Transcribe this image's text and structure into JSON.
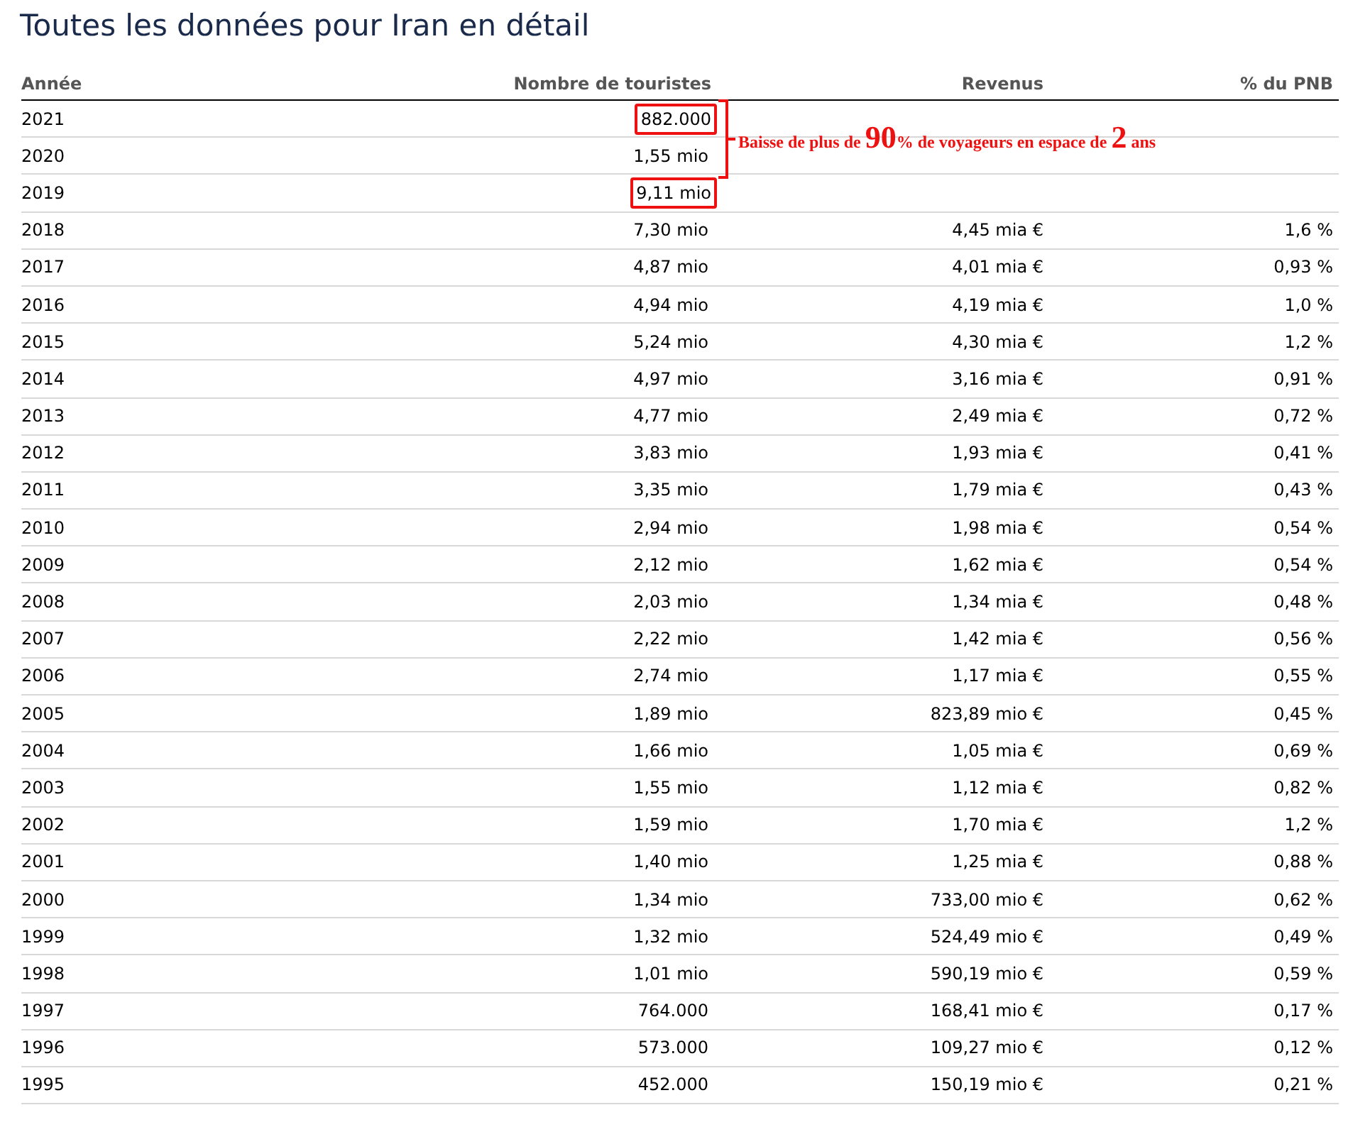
{
  "title": "Toutes les données pour Iran en détail",
  "columns": [
    "Année",
    "Nombre de touristes",
    "Revenus",
    "% du PNB"
  ],
  "rows": [
    {
      "year": "2021",
      "tourists": "882.000",
      "highlighted": true
    },
    {
      "year": "2020",
      "tourists": "1,55 mio",
      "highlighted": false
    },
    {
      "year": "2019",
      "tourists": "9,11 mio",
      "highlighted": true
    },
    {
      "year": "2018",
      "tourists": "7,30 mio",
      "revenue": "4,45 mia €",
      "gnp": "1,6 %",
      "highlighted": false
    },
    {
      "year": "2017",
      "tourists": "4,87 mio",
      "revenue": "4,01 mia €",
      "gnp": "0,93 %",
      "highlighted": false
    },
    {
      "year": "2016",
      "tourists": "4,94 mio",
      "revenue": "4,19 mia €",
      "gnp": "1,0 %",
      "highlighted": false
    },
    {
      "year": "2015",
      "tourists": "5,24 mio",
      "revenue": "4,30 mia €",
      "gnp": "1,2 %",
      "highlighted": false
    },
    {
      "year": "2014",
      "tourists": "4,97 mio",
      "revenue": "3,16 mia €",
      "gnp": "0,91 %",
      "highlighted": false
    },
    {
      "year": "2013",
      "tourists": "4,77 mio",
      "revenue": "2,49 mia €",
      "gnp": "0,72 %",
      "highlighted": false
    },
    {
      "year": "2012",
      "tourists": "3,83 mio",
      "revenue": "1,93 mia €",
      "gnp": "0,41 %",
      "highlighted": false
    },
    {
      "year": "2011",
      "tourists": "3,35 mio",
      "revenue": "1,79 mia €",
      "gnp": "0,43 %",
      "highlighted": false
    },
    {
      "year": "2010",
      "tourists": "2,94 mio",
      "revenue": "1,98 mia €",
      "gnp": "0,54 %",
      "highlighted": false
    },
    {
      "year": "2009",
      "tourists": "2,12 mio",
      "revenue": "1,62 mia €",
      "gnp": "0,54 %",
      "highlighted": false
    },
    {
      "year": "2008",
      "tourists": "2,03 mio",
      "revenue": "1,34 mia €",
      "gnp": "0,48 %",
      "highlighted": false
    },
    {
      "year": "2007",
      "tourists": "2,22 mio",
      "revenue": "1,42 mia €",
      "gnp": "0,56 %",
      "highlighted": false
    },
    {
      "year": "2006",
      "tourists": "2,74 mio",
      "revenue": "1,17 mia €",
      "gnp": "0,55 %",
      "highlighted": false
    },
    {
      "year": "2005",
      "tourists": "1,89 mio",
      "revenue": "823,89 mio €",
      "gnp": "0,45 %",
      "highlighted": false
    },
    {
      "year": "2004",
      "tourists": "1,66 mio",
      "revenue": "1,05 mia €",
      "gnp": "0,69 %",
      "highlighted": false
    },
    {
      "year": "2003",
      "tourists": "1,55 mio",
      "revenue": "1,12 mia €",
      "gnp": "0,82 %",
      "highlighted": false
    },
    {
      "year": "2002",
      "tourists": "1,59 mio",
      "revenue": "1,70 mia €",
      "gnp": "1,2 %",
      "highlighted": false
    },
    {
      "year": "2001",
      "tourists": "1,40 mio",
      "revenue": "1,25 mia €",
      "gnp": "0,88 %",
      "highlighted": false
    },
    {
      "year": "2000",
      "tourists": "1,34 mio",
      "revenue": "733,00 mio €",
      "gnp": "0,62 %",
      "highlighted": false
    },
    {
      "year": "1999",
      "tourists": "1,32 mio",
      "revenue": "524,49 mio €",
      "gnp": "0,49 %",
      "highlighted": false
    },
    {
      "year": "1998",
      "tourists": "1,01 mio",
      "revenue": "590,19 mio €",
      "gnp": "0,59 %",
      "highlighted": false
    },
    {
      "year": "1997",
      "tourists": "764.000",
      "revenue": "168,41 mio €",
      "gnp": "0,17 %",
      "highlighted": false
    },
    {
      "year": "1996",
      "tourists": "573.000",
      "revenue": "109,27 mio €",
      "gnp": "0,12 %",
      "highlighted": false
    },
    {
      "year": "1995",
      "tourists": "452.000",
      "revenue": "150,19 mio €",
      "gnp": "0,21 %",
      "highlighted": false
    }
  ],
  "annotation": [
    {
      "kind": "text",
      "text": "Baisse de plus de "
    },
    {
      "kind": "big",
      "text": "90"
    },
    {
      "kind": "text",
      "text": "% de voyageurs en espace de "
    },
    {
      "kind": "big",
      "text": "2"
    },
    {
      "kind": "text",
      "text": " ans"
    }
  ]
}
